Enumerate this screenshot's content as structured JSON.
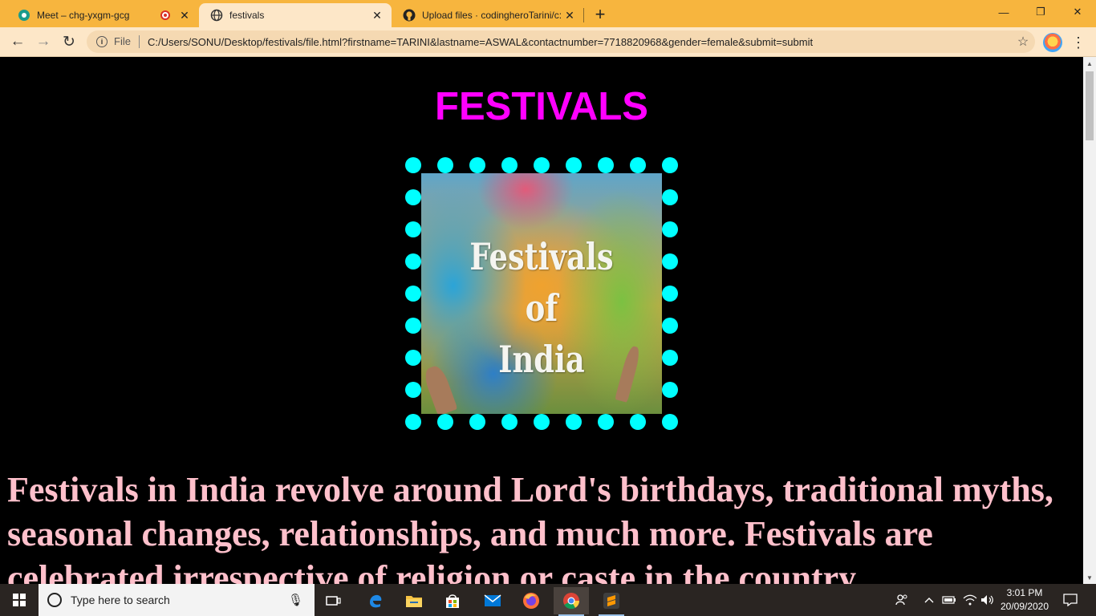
{
  "browser": {
    "tabs": [
      {
        "title": "Meet – chg-yxgm-gcg",
        "icon": "google-meet-icon",
        "recording": true
      },
      {
        "title": "festivals",
        "icon": "globe-icon",
        "active": true
      },
      {
        "title": "Upload files · codingheroTarini/c:",
        "icon": "github-icon"
      }
    ],
    "new_tab_label": "+",
    "window_controls": {
      "minimize": "—",
      "restore": "❐",
      "close": "✕"
    },
    "toolbar": {
      "back": "←",
      "forward": "→",
      "reload": "↻",
      "info_glyph": "i",
      "scheme_label": "File",
      "url": "C:/Users/SONU/Desktop/festivals/file.html?firstname=TARINI&lastname=ASWAL&contactnumber=7718820968&gender=female&submit=submit",
      "bookmark_glyph": "☆",
      "menu_glyph": "⋮"
    }
  },
  "page": {
    "title": "FESTIVALS",
    "title_color": "#ff00ff",
    "poster": {
      "text_lines": [
        "Festivals",
        "of",
        "India"
      ],
      "border_dot_color": "#00ffff"
    },
    "paragraph": "Festivals in India revolve around Lord's birthdays, traditional myths, seasonal changes, relationships, and much more. Festivals are celebrated irrespective of religion or caste in the country.",
    "paragraph_color": "#ffc0cb",
    "background": "#000000"
  },
  "taskbar": {
    "search_placeholder": "Type here to search",
    "pinned": [
      "task-view-icon",
      "edge-icon",
      "file-explorer-icon",
      "store-icon",
      "mail-icon",
      "firefox-icon",
      "chrome-icon",
      "sublime-text-icon"
    ],
    "clock_time": "3:01 PM",
    "clock_date": "20/09/2020"
  }
}
